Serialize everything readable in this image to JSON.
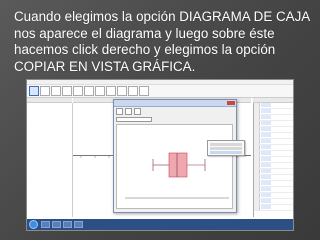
{
  "caption": {
    "lines": [
      "Cuando elegimos la opción DIAGRAMA DE CAJA",
      "nos aparece el diagrama y luego sobre éste",
      "hacemos click derecho y elegimos la opción",
      "COPIAR EN VISTA GRÁFICA."
    ]
  },
  "screenshot": {
    "icons": [
      "window-icon",
      "toolbar-icon",
      "box-plot-icon",
      "context-menu-icon",
      "windows-start-icon"
    ],
    "colors": {
      "box_fill": "#f0a8b0",
      "box_stroke": "#c0485a",
      "taskbar": "#2c4f86",
      "dialog_title": "#c9d7ef"
    }
  }
}
